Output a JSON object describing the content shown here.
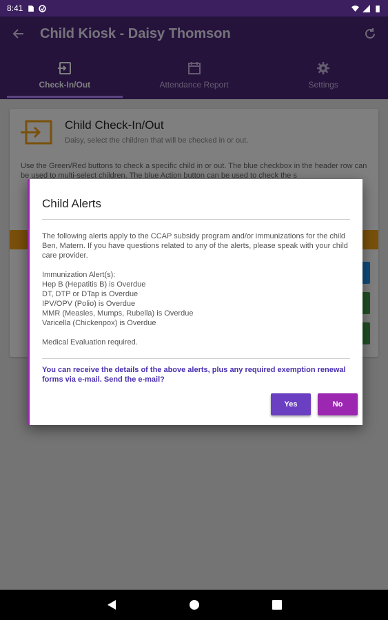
{
  "status_bar": {
    "time": "8:41"
  },
  "app_bar": {
    "title": "Child Kiosk - Daisy Thomson"
  },
  "tabs": [
    {
      "label": "Check-In/Out",
      "icon": "checkin-icon",
      "active": true
    },
    {
      "label": "Attendance Report",
      "icon": "calendar-icon",
      "active": false
    },
    {
      "label": "Settings",
      "icon": "gear-icon",
      "active": false
    }
  ],
  "card": {
    "title": "Child Check-In/Out",
    "subtitle": "Daisy, select the children that will be checked in or out.",
    "help": "Use the Green/Red buttons to check a specific child in or out.  The blue checkbox in the header row can be used to multi-select children.  The blue Action button can be used to check the s"
  },
  "dialog": {
    "title": "Child Alerts",
    "intro": "The following alerts apply to the CCAP subsidy program and/or immunizations for the child Ben, Matern.  If you have questions related to any of the alerts, please speak with your child care provider.",
    "immunization_header": "Immunization Alert(s):",
    "alerts": [
      "Hep B (Hepatitis B) is Overdue",
      "DT, DTP or DTap is Overdue",
      "IPV/OPV (Polio) is Overdue",
      "MMR (Measles, Mumps, Rubella) is Overdue",
      "Varicella (Chickenpox) is Overdue"
    ],
    "medical": "Medical Evaluation required.",
    "question": "You can receive the details of the above alerts, plus any required exemption renewal forms via e-mail.  Send the e-mail?",
    "yes_label": "Yes",
    "no_label": "No"
  },
  "colors": {
    "app_bar": "#4a2679",
    "accent": "#9c27b0",
    "yes": "#6a3fc1",
    "question": "#4a2fb0"
  }
}
